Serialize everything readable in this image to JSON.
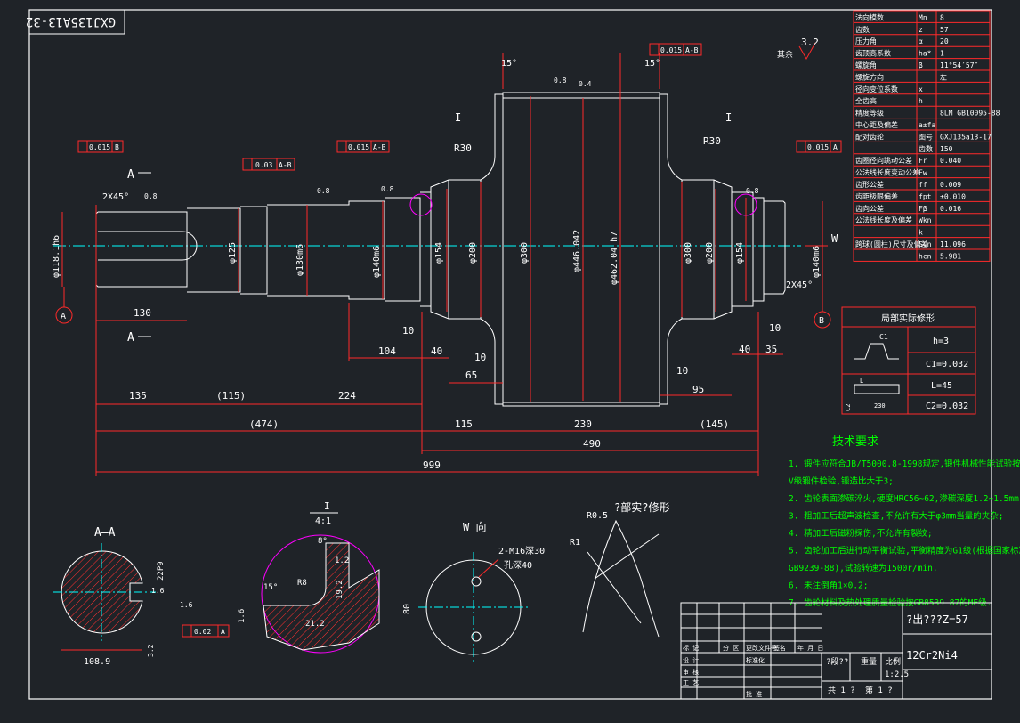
{
  "colors": {
    "background": "#1f2328",
    "outline": "#ffffff",
    "dimension": "#ff2a2a",
    "text_green": "#00ff00",
    "centerline": "#00ffff",
    "detail_circle": "#ff00ff",
    "hatch": "#ff3030"
  },
  "title_tag": "GXJ135A13-32",
  "surface_symbol": {
    "value": "3.2",
    "note": "其余"
  },
  "param_table": [
    [
      "法向模数",
      "Mn",
      "8"
    ],
    [
      "齿数",
      "z",
      "57"
    ],
    [
      "压力角",
      "α",
      "20"
    ],
    [
      "齿顶高系数",
      "ha*",
      "1"
    ],
    [
      "螺旋角",
      "β",
      "11°54′57″"
    ],
    [
      "螺旋方向",
      "",
      "左"
    ],
    [
      "径向变位系数",
      "x",
      ""
    ],
    [
      "全齿高",
      "h",
      ""
    ],
    [
      "精度等级",
      "",
      "8LM GB10095-88"
    ],
    [
      "中心距及偏差",
      "a±fa",
      ""
    ],
    [
      "配对齿轮",
      "图号",
      "GXJ135a13-17"
    ],
    [
      "",
      "齿数",
      "150"
    ],
    [
      "齿圈径向跳动公差",
      "Fr",
      "0.040"
    ],
    [
      "公法线长度变动公差",
      "Fw",
      ""
    ],
    [
      "齿形公差",
      "ff",
      "0.009"
    ],
    [
      "齿距极限偏差",
      "fpt",
      "±0.010"
    ],
    [
      "齿向公差",
      "Fβ",
      "0.016"
    ],
    [
      "公法线长度及偏差",
      "Wkn",
      ""
    ],
    [
      "",
      "k",
      ""
    ],
    [
      "跨球(圆柱)尺寸及偏差",
      "Scn",
      "11.096"
    ],
    [
      "",
      "hcn",
      "5.981"
    ]
  ],
  "local_section": {
    "title": "局部实际修形",
    "rows": [
      [
        "",
        "h=3"
      ],
      [
        "",
        "C1=0.032"
      ],
      [
        "",
        "L=45"
      ],
      [
        "",
        "C2=0.032"
      ]
    ],
    "label_c1": "C1",
    "label_230": "230",
    "label_l": "L",
    "label_c2": "C2"
  },
  "tech_req": {
    "title": "技术要求",
    "items": [
      "1. 锻件应符合JB/T5000.8-1998规定,锻件机械性能试验按",
      "   V级锻件检验,锻造比大于3;",
      "2. 齿轮表面渗碳淬火,硬度HRC56~62,渗碳深度1.2~1.5mm;",
      "3. 粗加工后超声波检查,不允许有大于φ3mm当量的夹杂;",
      "4. 精加工后磁粉探伤,不允许有裂纹;",
      "5. 齿轮加工后进行动平衡试验,平衡精度为G1级(根据国家标准",
      "   GB9239-88),试验转速为1500r/min.",
      "6. 未注倒角1×0.2;",
      "7. 齿轮材料及热处理质量检验按GB8539-87的ME级."
    ]
  },
  "title_block": {
    "code": "?出???Z=57",
    "material": "12Cr2Ni4",
    "scale": "1:2.5",
    "h_weight": "重量",
    "h_ratio": "比例",
    "h_mark": "?段??",
    "h_process": "分 区",
    "h_doc": "更改文件号",
    "h_sign": "签名",
    "h_date": "年 月 日",
    "sheet_a": "共 1 ?",
    "sheet_b": "第 1 ?",
    "row_design": "设 计",
    "row_check": "审 核",
    "row_craft": "工 艺",
    "row_std": "标准化",
    "row_approve": "批 准",
    "row_mark": "标 记"
  },
  "views": {
    "aa_title": "A—A",
    "detail_title": "I",
    "detail_scale": "4:1",
    "w_title": "W 向",
    "mod_title": "?部实?修形",
    "section_marker_a": "A",
    "datum_a": "A",
    "datum_b": "B",
    "w_label": "W",
    "detail_i": "I"
  },
  "dims": {
    "d_left_shaft": "φ118.1h6",
    "d_125": "φ125",
    "d_130": "φ130m6",
    "d_140": "φ140m6",
    "d_154": "φ154",
    "d_200": "φ200",
    "d_300": "φ300",
    "d_446": "φ446.042",
    "d_462": "φ462.04 h7",
    "d_300r": "φ300",
    "d_200r": "φ200",
    "d_154r": "φ154",
    "d_140r": "φ140m6",
    "l_130": "130",
    "l_135": "135",
    "l_115p": "(115)",
    "l_224": "224",
    "l_474": "(474)",
    "l_115": "115",
    "l_230": "230",
    "l_145": "(145)",
    "l_490": "490",
    "l_999": "999",
    "l_104": "104",
    "l_40": "40",
    "l_10a": "10",
    "l_10b": "10",
    "l_65": "65",
    "l_10c": "10",
    "l_95": "95",
    "l_40r": "40",
    "l_35": "35",
    "l_10r": "10",
    "r30a": "R30",
    "r30b": "R30",
    "chamfer_l": "2X45°",
    "chamfer_r": "2X45°",
    "ang15a": "15°",
    "ang15b": "15°",
    "gt1": "0.015",
    "gt1d": "B",
    "gt2": "0.03",
    "gt2d": "A-B",
    "gt3": "0.015",
    "gt3d": "A-B",
    "gt4": "0.015",
    "gt4d": "A-B",
    "gt5": "0.015",
    "gt5d": "A",
    "gt6": "0.02",
    "gt6d": "A",
    "r08": "0.8",
    "r04": "0.4",
    "r16": "1.6",
    "aa_dim": "108.9",
    "aa_22p": "22P9",
    "aa_16": "1.6",
    "aa_32": "3.2",
    "det_8": "8°",
    "det_12": "1.2",
    "det_r8": "R8",
    "det_192": "19.2",
    "det_212": "21.2",
    "det_15": "15°",
    "det_16": "1.6",
    "w_thread": "2-M16深30",
    "w_hole": "孔深40",
    "w_80": "80",
    "mod_r05": "R0.5",
    "mod_r1": "R1"
  }
}
